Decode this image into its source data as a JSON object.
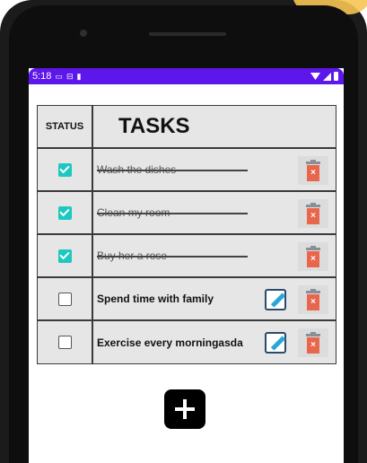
{
  "status_bar": {
    "time": "5:18",
    "icons": [
      "cast-icon",
      "sim-icon",
      "sd-card-icon"
    ],
    "right_icons": [
      "wifi-icon",
      "signal-icon",
      "battery-icon"
    ],
    "color": "#5e17eb"
  },
  "table": {
    "header": {
      "status": "STATUS",
      "tasks": "TASKS"
    },
    "rows": [
      {
        "label": "Wash the dishes",
        "done": true
      },
      {
        "label": "Clean my room",
        "done": true
      },
      {
        "label": "Buy her a rose",
        "done": true
      },
      {
        "label": "Spend time with family",
        "done": false
      },
      {
        "label": "Exercise every morningasda",
        "done": false
      }
    ]
  },
  "colors": {
    "checked": "#1cc8bf",
    "delete": "#e8664c",
    "accent": "#5e17eb"
  },
  "add_button": {
    "icon": "plus-icon"
  }
}
